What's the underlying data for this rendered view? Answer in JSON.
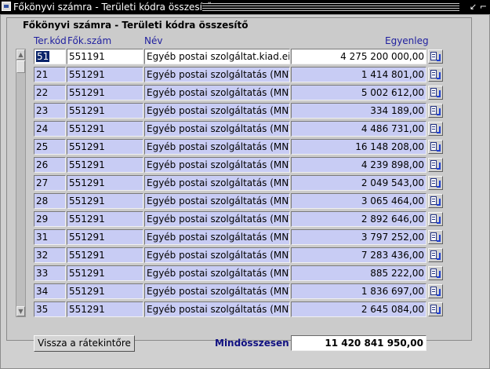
{
  "window": {
    "title": "Főkönyvi számra - Területi kódra összesítő"
  },
  "section": {
    "title": "Főkönyvi számra - Területi kódra összesítő"
  },
  "columns": {
    "ter_kod": "Ter.kód",
    "fok_szam": "Fők.szám",
    "nev": "Név",
    "egyenleg": "Egyenleg"
  },
  "rows": [
    {
      "ter_kod": "51",
      "fok_szam": "551191",
      "nev": "Egyéb postai szolgáltat.kiad.ei.",
      "egyenleg": "4 275 200 000,00"
    },
    {
      "ter_kod": "21",
      "fok_szam": "551291",
      "nev": "Egyéb postai szolgáltatás (MNY",
      "egyenleg": "1 414 801,00"
    },
    {
      "ter_kod": "22",
      "fok_szam": "551291",
      "nev": "Egyéb postai szolgáltatás (MNY",
      "egyenleg": "5 002 612,00"
    },
    {
      "ter_kod": "23",
      "fok_szam": "551291",
      "nev": "Egyéb postai szolgáltatás (MNY",
      "egyenleg": "334 189,00"
    },
    {
      "ter_kod": "24",
      "fok_szam": "551291",
      "nev": "Egyéb postai szolgáltatás (MNY",
      "egyenleg": "4 486 731,00"
    },
    {
      "ter_kod": "25",
      "fok_szam": "551291",
      "nev": "Egyéb postai szolgáltatás (MNY",
      "egyenleg": "16 148 208,00"
    },
    {
      "ter_kod": "26",
      "fok_szam": "551291",
      "nev": "Egyéb postai szolgáltatás (MNY",
      "egyenleg": "4 239 898,00"
    },
    {
      "ter_kod": "27",
      "fok_szam": "551291",
      "nev": "Egyéb postai szolgáltatás (MNY",
      "egyenleg": "2 049 543,00"
    },
    {
      "ter_kod": "28",
      "fok_szam": "551291",
      "nev": "Egyéb postai szolgáltatás (MNY",
      "egyenleg": "3 065 464,00"
    },
    {
      "ter_kod": "29",
      "fok_szam": "551291",
      "nev": "Egyéb postai szolgáltatás (MNY",
      "egyenleg": "2 892 646,00"
    },
    {
      "ter_kod": "31",
      "fok_szam": "551291",
      "nev": "Egyéb postai szolgáltatás (MNY",
      "egyenleg": "3 797 252,00"
    },
    {
      "ter_kod": "32",
      "fok_szam": "551291",
      "nev": "Egyéb postai szolgáltatás (MNY",
      "egyenleg": "7 283 436,00"
    },
    {
      "ter_kod": "33",
      "fok_szam": "551291",
      "nev": "Egyéb postai szolgáltatás (MNY",
      "egyenleg": "885 222,00"
    },
    {
      "ter_kod": "34",
      "fok_szam": "551291",
      "nev": "Egyéb postai szolgáltatás (MNY",
      "egyenleg": "1 836 697,00"
    },
    {
      "ter_kod": "35",
      "fok_szam": "551291",
      "nev": "Egyéb postai szolgáltatás (MNY",
      "egyenleg": "2 645 084,00"
    }
  ],
  "footer": {
    "back_button": "Vissza a rátekintőre",
    "total_label": "Mindösszesen",
    "total_value": "11 420 841 950,00"
  },
  "icons": {
    "app": "oracle-forms-window-icon",
    "row_detail": "drill-down-document-icon"
  },
  "colors": {
    "row_bg": "#c8ccf4",
    "current_row_bg": "#ffffff",
    "header_text": "#1f1f9f",
    "total_label": "#101080",
    "selection": "#0a246a"
  }
}
